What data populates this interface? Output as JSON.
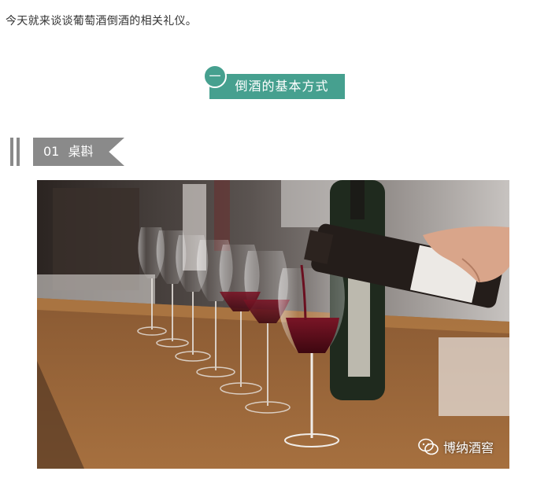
{
  "intro": {
    "text": "今天就来谈谈葡萄酒倒酒的相关礼仪。"
  },
  "section": {
    "number": "一",
    "title": "倒酒的基本方式"
  },
  "subsection": {
    "label": "01 桌斟"
  },
  "photo": {
    "watermark": "博纳酒窖",
    "watermark_icon": "wechat-icon"
  },
  "colors": {
    "accent": "#46a08f",
    "subheading": "#8a8a8a",
    "text": "#333333"
  }
}
